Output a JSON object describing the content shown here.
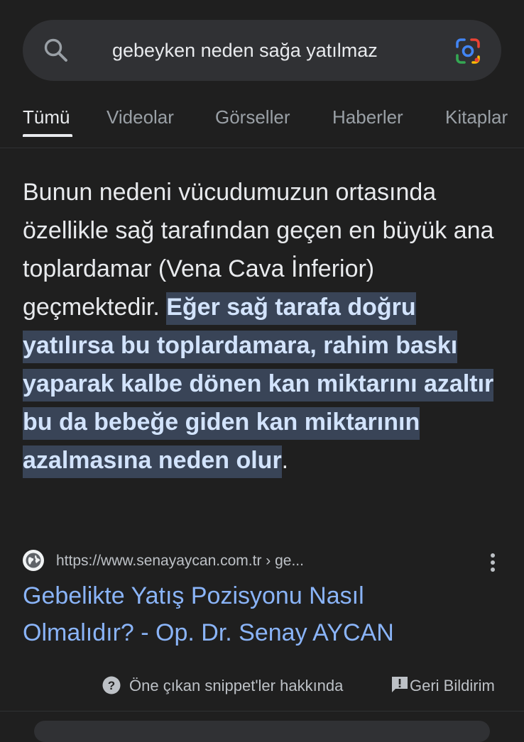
{
  "search": {
    "query": "gebeyken neden sağa yatılmaz"
  },
  "tabs": [
    {
      "label": "Tümü",
      "active": true
    },
    {
      "label": "Videolar",
      "active": false
    },
    {
      "label": "Görseller",
      "active": false
    },
    {
      "label": "Haberler",
      "active": false
    },
    {
      "label": "Kitaplar",
      "active": false
    }
  ],
  "snippet": {
    "plain_text": "Bunun nedeni vücudumuzun ortasında özellikle sağ tarafından geçen en büyük ana toplardamar (Vena Cava İnferior) geçmektedir. ",
    "highlighted_text": "Eğer sağ tarafa doğru yatılırsa bu toplardamara, rahim baskı yaparak kalbe dönen kan miktarını azaltır bu da bebeğe giden kan miktarının azalmasına neden olur",
    "trailing_text": "."
  },
  "result": {
    "url": "https://www.senayaycan.com.tr › ge...",
    "title": "Gebelikte Yatış Pozisyonu Nasıl Olmalıdır? - Op. Dr. Senay AYCAN"
  },
  "footer": {
    "about_label": "Öne çıkan snippet'ler hakkında",
    "feedback_label": "Geri Bildirim"
  },
  "colors": {
    "background": "#1f1f1f",
    "search_bar": "#303134",
    "link": "#8ab4f8",
    "highlight_bg": "#394457",
    "highlight_text": "#d2e3fc"
  },
  "icons": {
    "search": "search-icon",
    "lens": "google-lens-icon",
    "favicon": "globe-icon",
    "more": "more-vert-icon",
    "about": "help-circle-icon",
    "feedback": "feedback-icon"
  }
}
